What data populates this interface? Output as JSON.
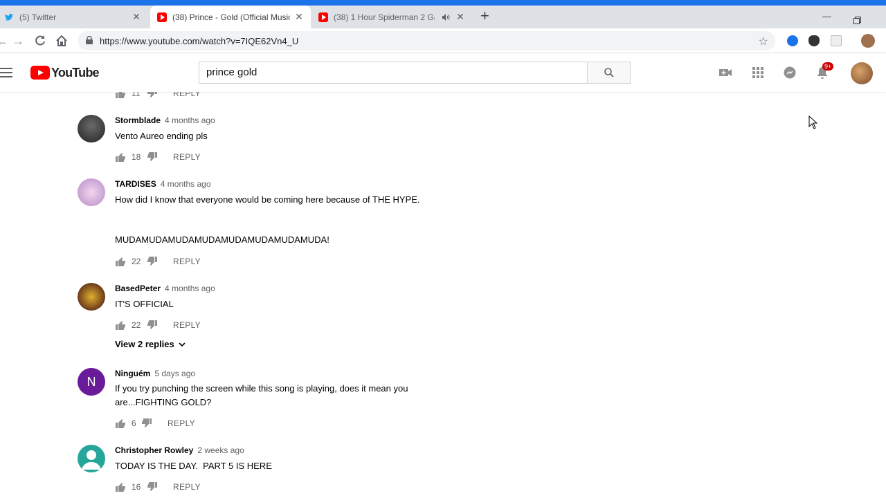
{
  "browser": {
    "tabs": [
      {
        "title": "(5) Twitter",
        "favicon": "twitter-icon"
      },
      {
        "title": "(38) Prince - Gold (Official Music",
        "favicon": "youtube-icon",
        "active": true
      },
      {
        "title": "(38) 1 Hour Spiderman 2 Ga",
        "favicon": "youtube-icon",
        "muted": true
      }
    ],
    "new_tab": "+",
    "url": "https://www.youtube.com/watch?v=7IQE62Vn4_U"
  },
  "youtube": {
    "logo_text": "YouTube",
    "search_value": "prince gold",
    "notifications_badge": "9+",
    "brand_color": "#ff0000"
  },
  "comments": {
    "partial_top": {
      "likes": "11",
      "reply": "REPLY"
    },
    "items": [
      {
        "author": "Stormblade",
        "time": "4 months ago",
        "text": [
          "Vento Aureo ending pls"
        ],
        "likes": "18",
        "reply": "REPLY"
      },
      {
        "author": "TARDISES",
        "time": "4 months ago",
        "text": [
          "How did I know that everyone would be coming here because of THE HYPE.",
          "",
          "MUDAMUDAMUDAMUDAMUDAMUDAMUDAMUDA!"
        ],
        "likes": "22",
        "reply": "REPLY"
      },
      {
        "author": "BasedPeter",
        "time": "4 months ago",
        "text": [
          "IT'S OFFICIAL"
        ],
        "likes": "22",
        "reply": "REPLY",
        "view_replies": "View 2 replies"
      },
      {
        "author": "Ninguém",
        "time": "5 days ago",
        "text": [
          "If you try punching the screen while this song is playing, does it mean you",
          "are...FIGHTING GOLD?"
        ],
        "likes": "6",
        "reply": "REPLY",
        "avatar_letter": "N"
      },
      {
        "author": "Christopher Rowley",
        "time": "2 weeks ago",
        "text": [
          "TODAY IS THE DAY.  PART 5 IS HERE"
        ],
        "likes": "16",
        "reply": "REPLY"
      }
    ]
  }
}
